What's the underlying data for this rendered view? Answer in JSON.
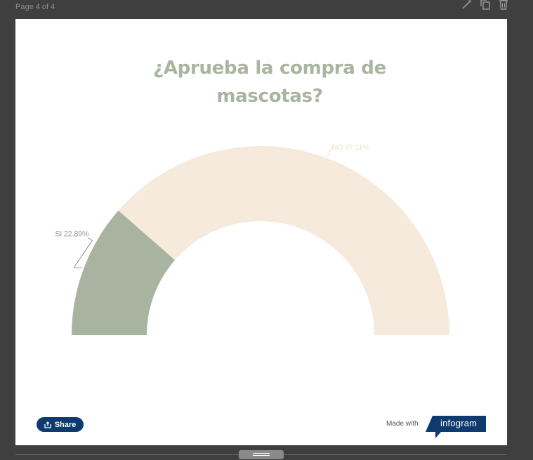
{
  "editor": {
    "page_label": "Page 4 of 4",
    "toolbar_icons": [
      "magic-wand-icon",
      "duplicate-icon",
      "trash-icon"
    ]
  },
  "chart_data": {
    "type": "pie",
    "variant": "semi-donut",
    "title": "¿Aprueba la compra de mascotas?",
    "title_lines": [
      "¿Aprueba la compra de",
      "mascotas?"
    ],
    "series": [
      {
        "name": "SI",
        "value": 22.89,
        "label": "SI 22.89%",
        "color": "#a8b4a0"
      },
      {
        "name": "NO",
        "value": 77.11,
        "label": "NO 77.11%",
        "color": "#f5eadb"
      }
    ],
    "label_colors": {
      "SI": "#9aa490",
      "NO": "#ece0cc"
    },
    "legend": "none"
  },
  "footer": {
    "share_label": "Share",
    "made_with": "Made with",
    "brand": "infogram",
    "brand_color": "#0f3a6e"
  }
}
